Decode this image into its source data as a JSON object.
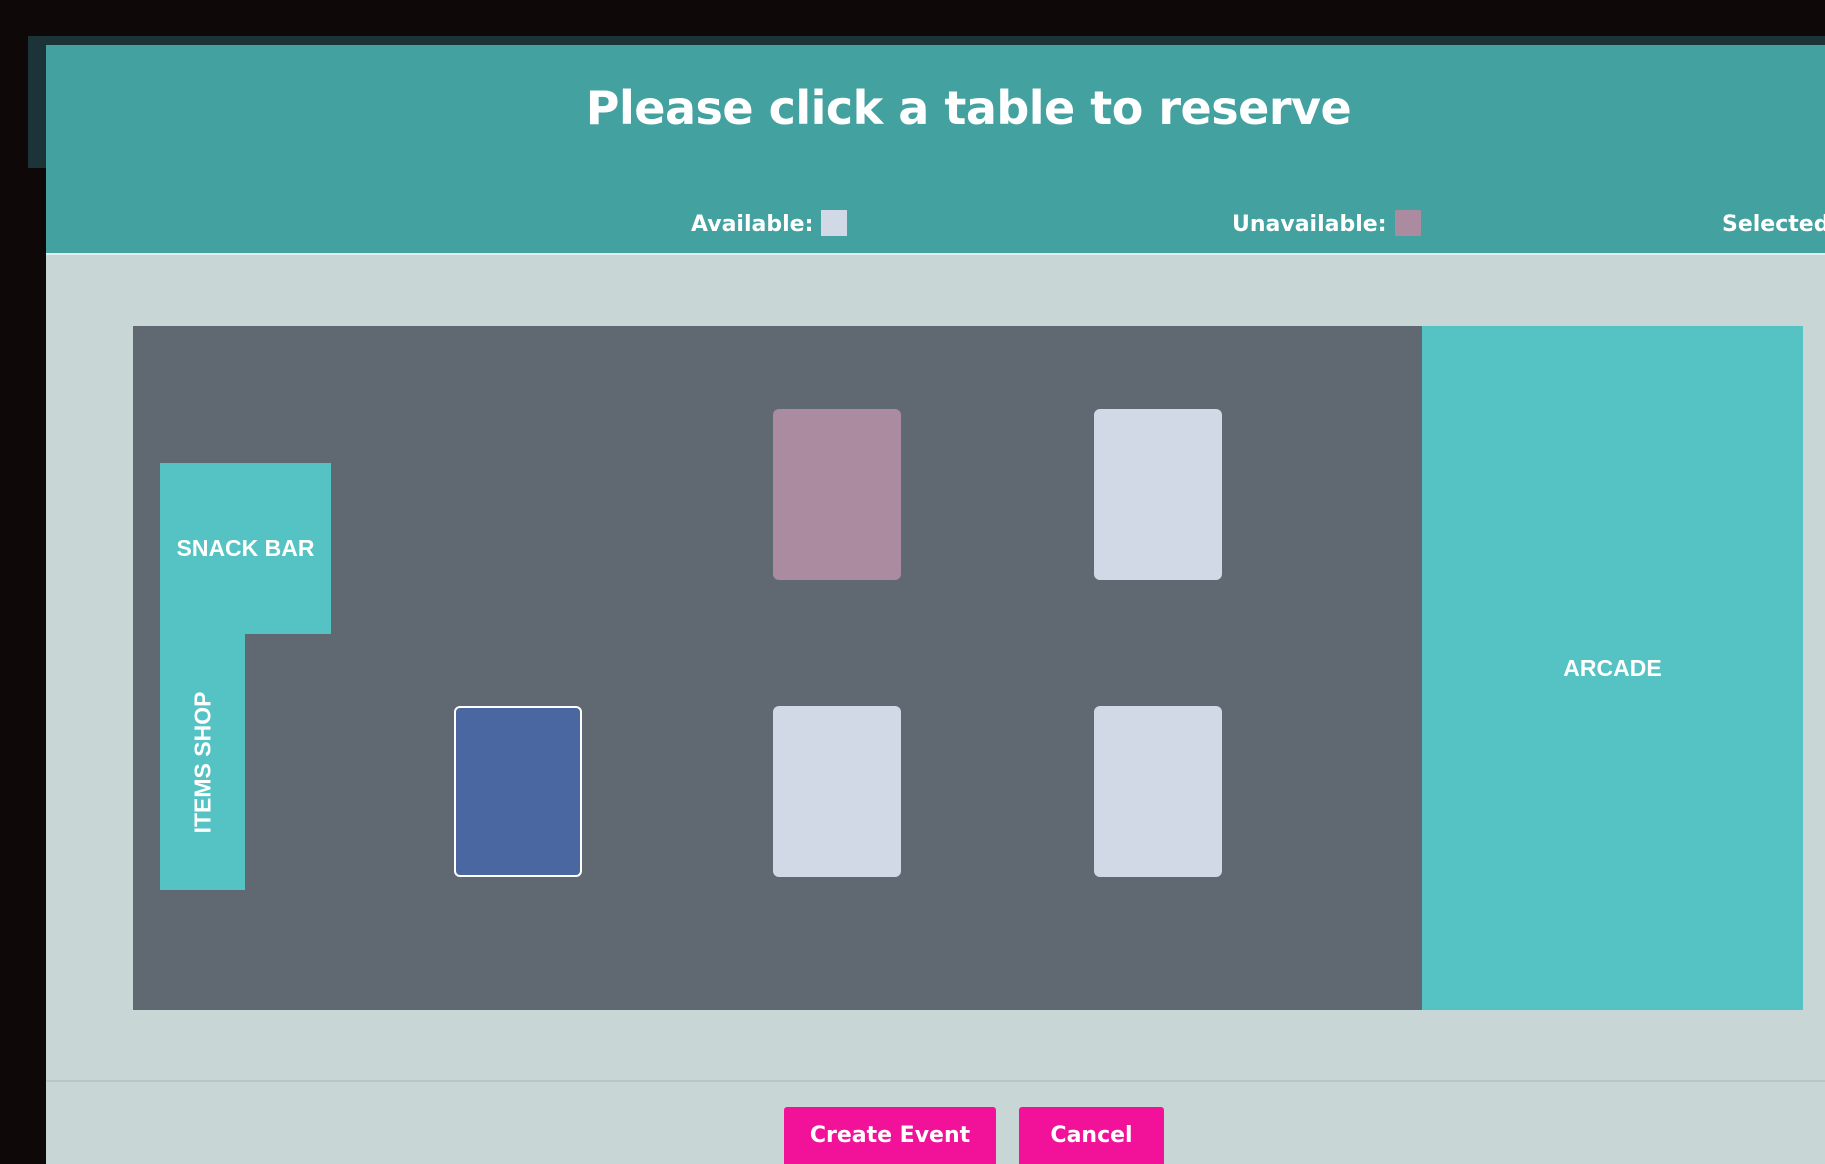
{
  "header": {
    "title": "Please click a table to reserve",
    "legend": [
      {
        "label": "Available:",
        "color": "#d2d9e6"
      },
      {
        "label": "Unavailable:",
        "color": "#aa8b9f"
      },
      {
        "label": "Selected:",
        "color": "#4a67a2"
      }
    ]
  },
  "floor_plan": {
    "zones": {
      "snack_bar": "SNACK BAR",
      "items_shop": "ITEMS SHOP",
      "arcade": "ARCADE"
    },
    "tables": [
      {
        "row": 1,
        "col": 2,
        "status": "unavailable"
      },
      {
        "row": 1,
        "col": 3,
        "status": "available"
      },
      {
        "row": 2,
        "col": 1,
        "status": "selected"
      },
      {
        "row": 2,
        "col": 2,
        "status": "available"
      },
      {
        "row": 2,
        "col": 3,
        "status": "available"
      }
    ],
    "colors": {
      "floor": "#606872",
      "zone": "#55c2c3",
      "header": "#43a1a0",
      "button": "#f2129a"
    }
  },
  "footer": {
    "create_event_label": "Create Event",
    "cancel_label": "Cancel"
  }
}
